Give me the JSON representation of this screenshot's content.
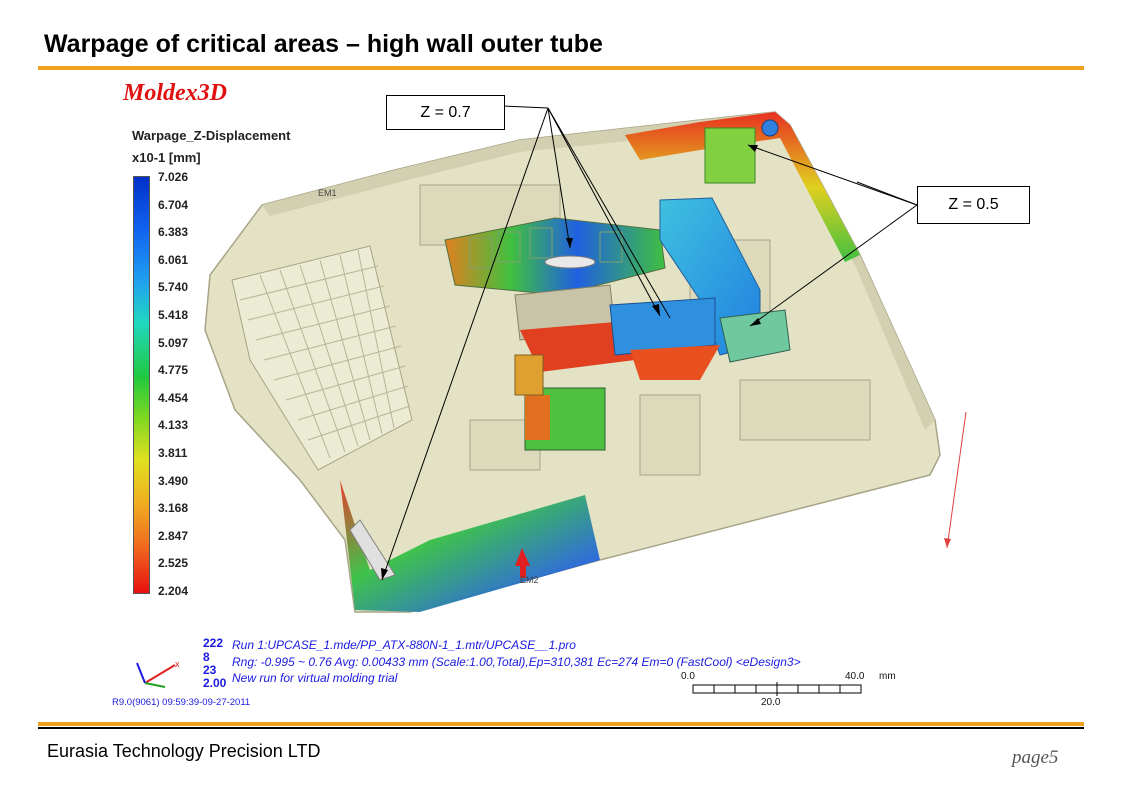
{
  "slide": {
    "title": "Warpage of critical areas – high wall outer tube",
    "footer_company": "Eurasia Technology Precision LTD",
    "page_label": "page5"
  },
  "colors": {
    "accent": "#f0a020",
    "brand_red": "#e01010",
    "info_blue": "#1a1ae0",
    "part_beige": "#e4e2c4"
  },
  "figure": {
    "brand": "Moldex3D",
    "legend": {
      "title": "Warpage_Z-Displacement",
      "unit": "x10-1  [mm]",
      "ticks": [
        "7.026",
        "6.704",
        "6.383",
        "6.061",
        "5.740",
        "5.418",
        "5.097",
        "4.775",
        "4.454",
        "4.133",
        "3.811",
        "3.490",
        "3.168",
        "2.847",
        "2.525",
        "2.204"
      ]
    },
    "callouts": {
      "z_high": "Z = 0.7",
      "z_low": "Z = 0.5"
    },
    "markers": {
      "em1": "EM1",
      "em2": "EM2"
    },
    "info": {
      "numbers": [
        "222",
        "8",
        "23",
        "2.00"
      ],
      "line1": "Run 1:UPCASE_1.mde/PP_ATX-880N-1_1.mtr/UPCASE__1.pro",
      "line2": "Rng: -0.995 ~ 0.76   Avg: 0.00433 mm (Scale:1.00,Total),Ep=310,381 Ec=274 Em=0 (FastCool) <eDesign3>",
      "line3": "New run for virtual molding trial",
      "version": "R9.0(9061) 09:59:39-09-27-2011"
    },
    "scale": {
      "start": "0.0",
      "end": "40.0",
      "unit": "mm",
      "mid": "20.0"
    }
  }
}
